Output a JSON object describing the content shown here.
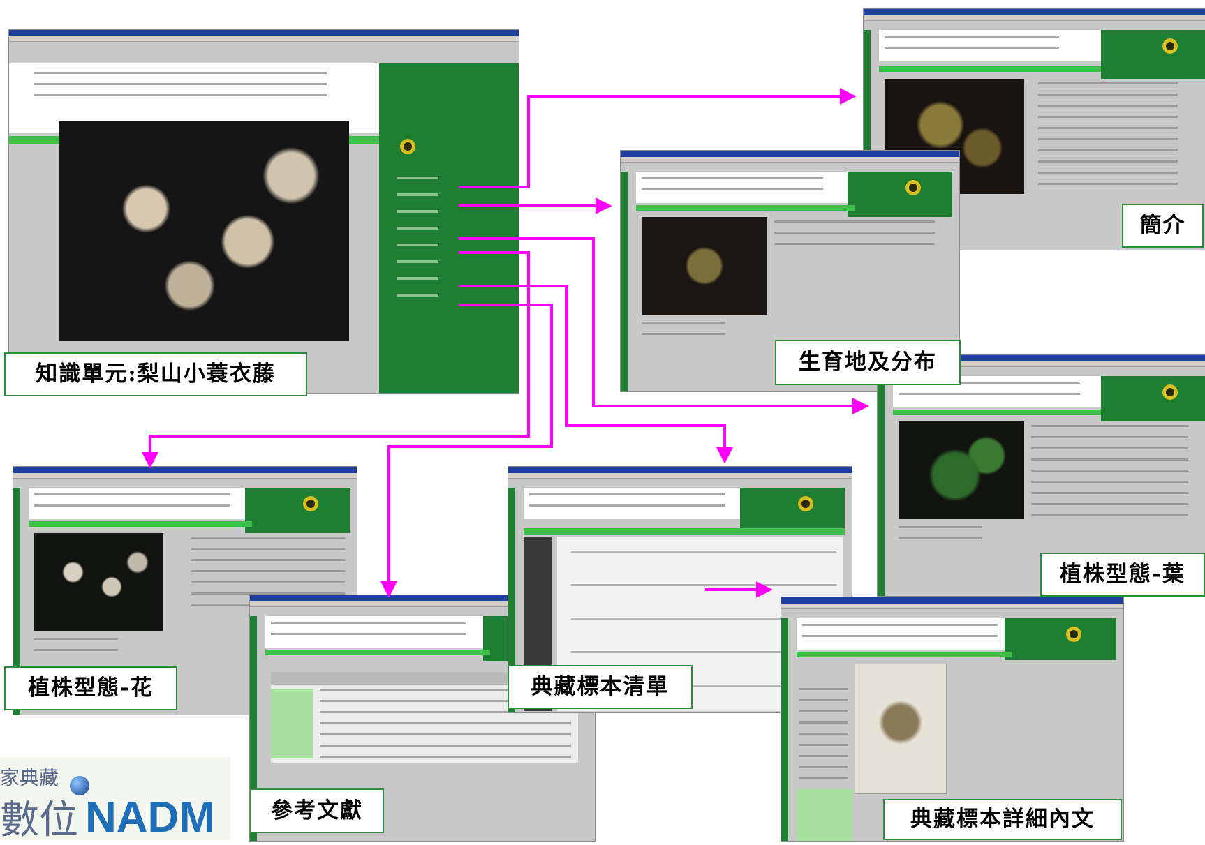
{
  "labels": {
    "main": "知識單元:梨山小蓑衣藤",
    "intro": "簡介",
    "habitat": "生育地及分布",
    "leaf": "植株型態-葉",
    "flower": "植株型態-花",
    "references": "參考文獻",
    "specimen_list": "典藏標本清單",
    "specimen_detail": "典藏標本詳細內文"
  },
  "watermark": {
    "top_text": "家典藏",
    "bottom_cjk": "數位",
    "bottom_latin": "NADM"
  },
  "colors": {
    "arrow": "#ff00ff",
    "label_border": "#2e8b3a",
    "site_green": "#1e7e32",
    "stripe_green": "#3dbf4a"
  }
}
